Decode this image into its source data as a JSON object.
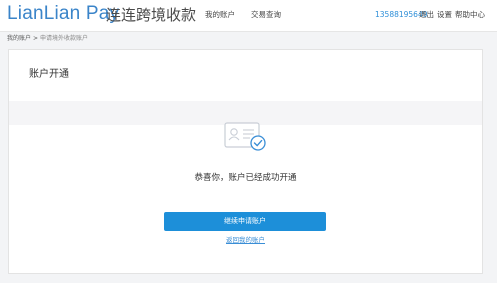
{
  "header": {
    "logo_text": "LianLian Pay",
    "logo_cn": "连连跨境收款",
    "nav": [
      "我的账户",
      "交易查询"
    ],
    "phone": "13588195649",
    "links": [
      "退出",
      "设置",
      "帮助中心"
    ]
  },
  "breadcrumb": {
    "items": [
      "我的账户",
      "申请境外收款账户"
    ],
    "separator": ">"
  },
  "card": {
    "title": "账户开通",
    "icon": "id-card-check-icon",
    "success_message": "恭喜你，账户已经成功开通",
    "primary_button": "继续申请账户",
    "back_link": "返回我的账户"
  },
  "colors": {
    "brand": "#3a84c9",
    "primary_button": "#1d8fd9",
    "link": "#3a8ed6"
  }
}
